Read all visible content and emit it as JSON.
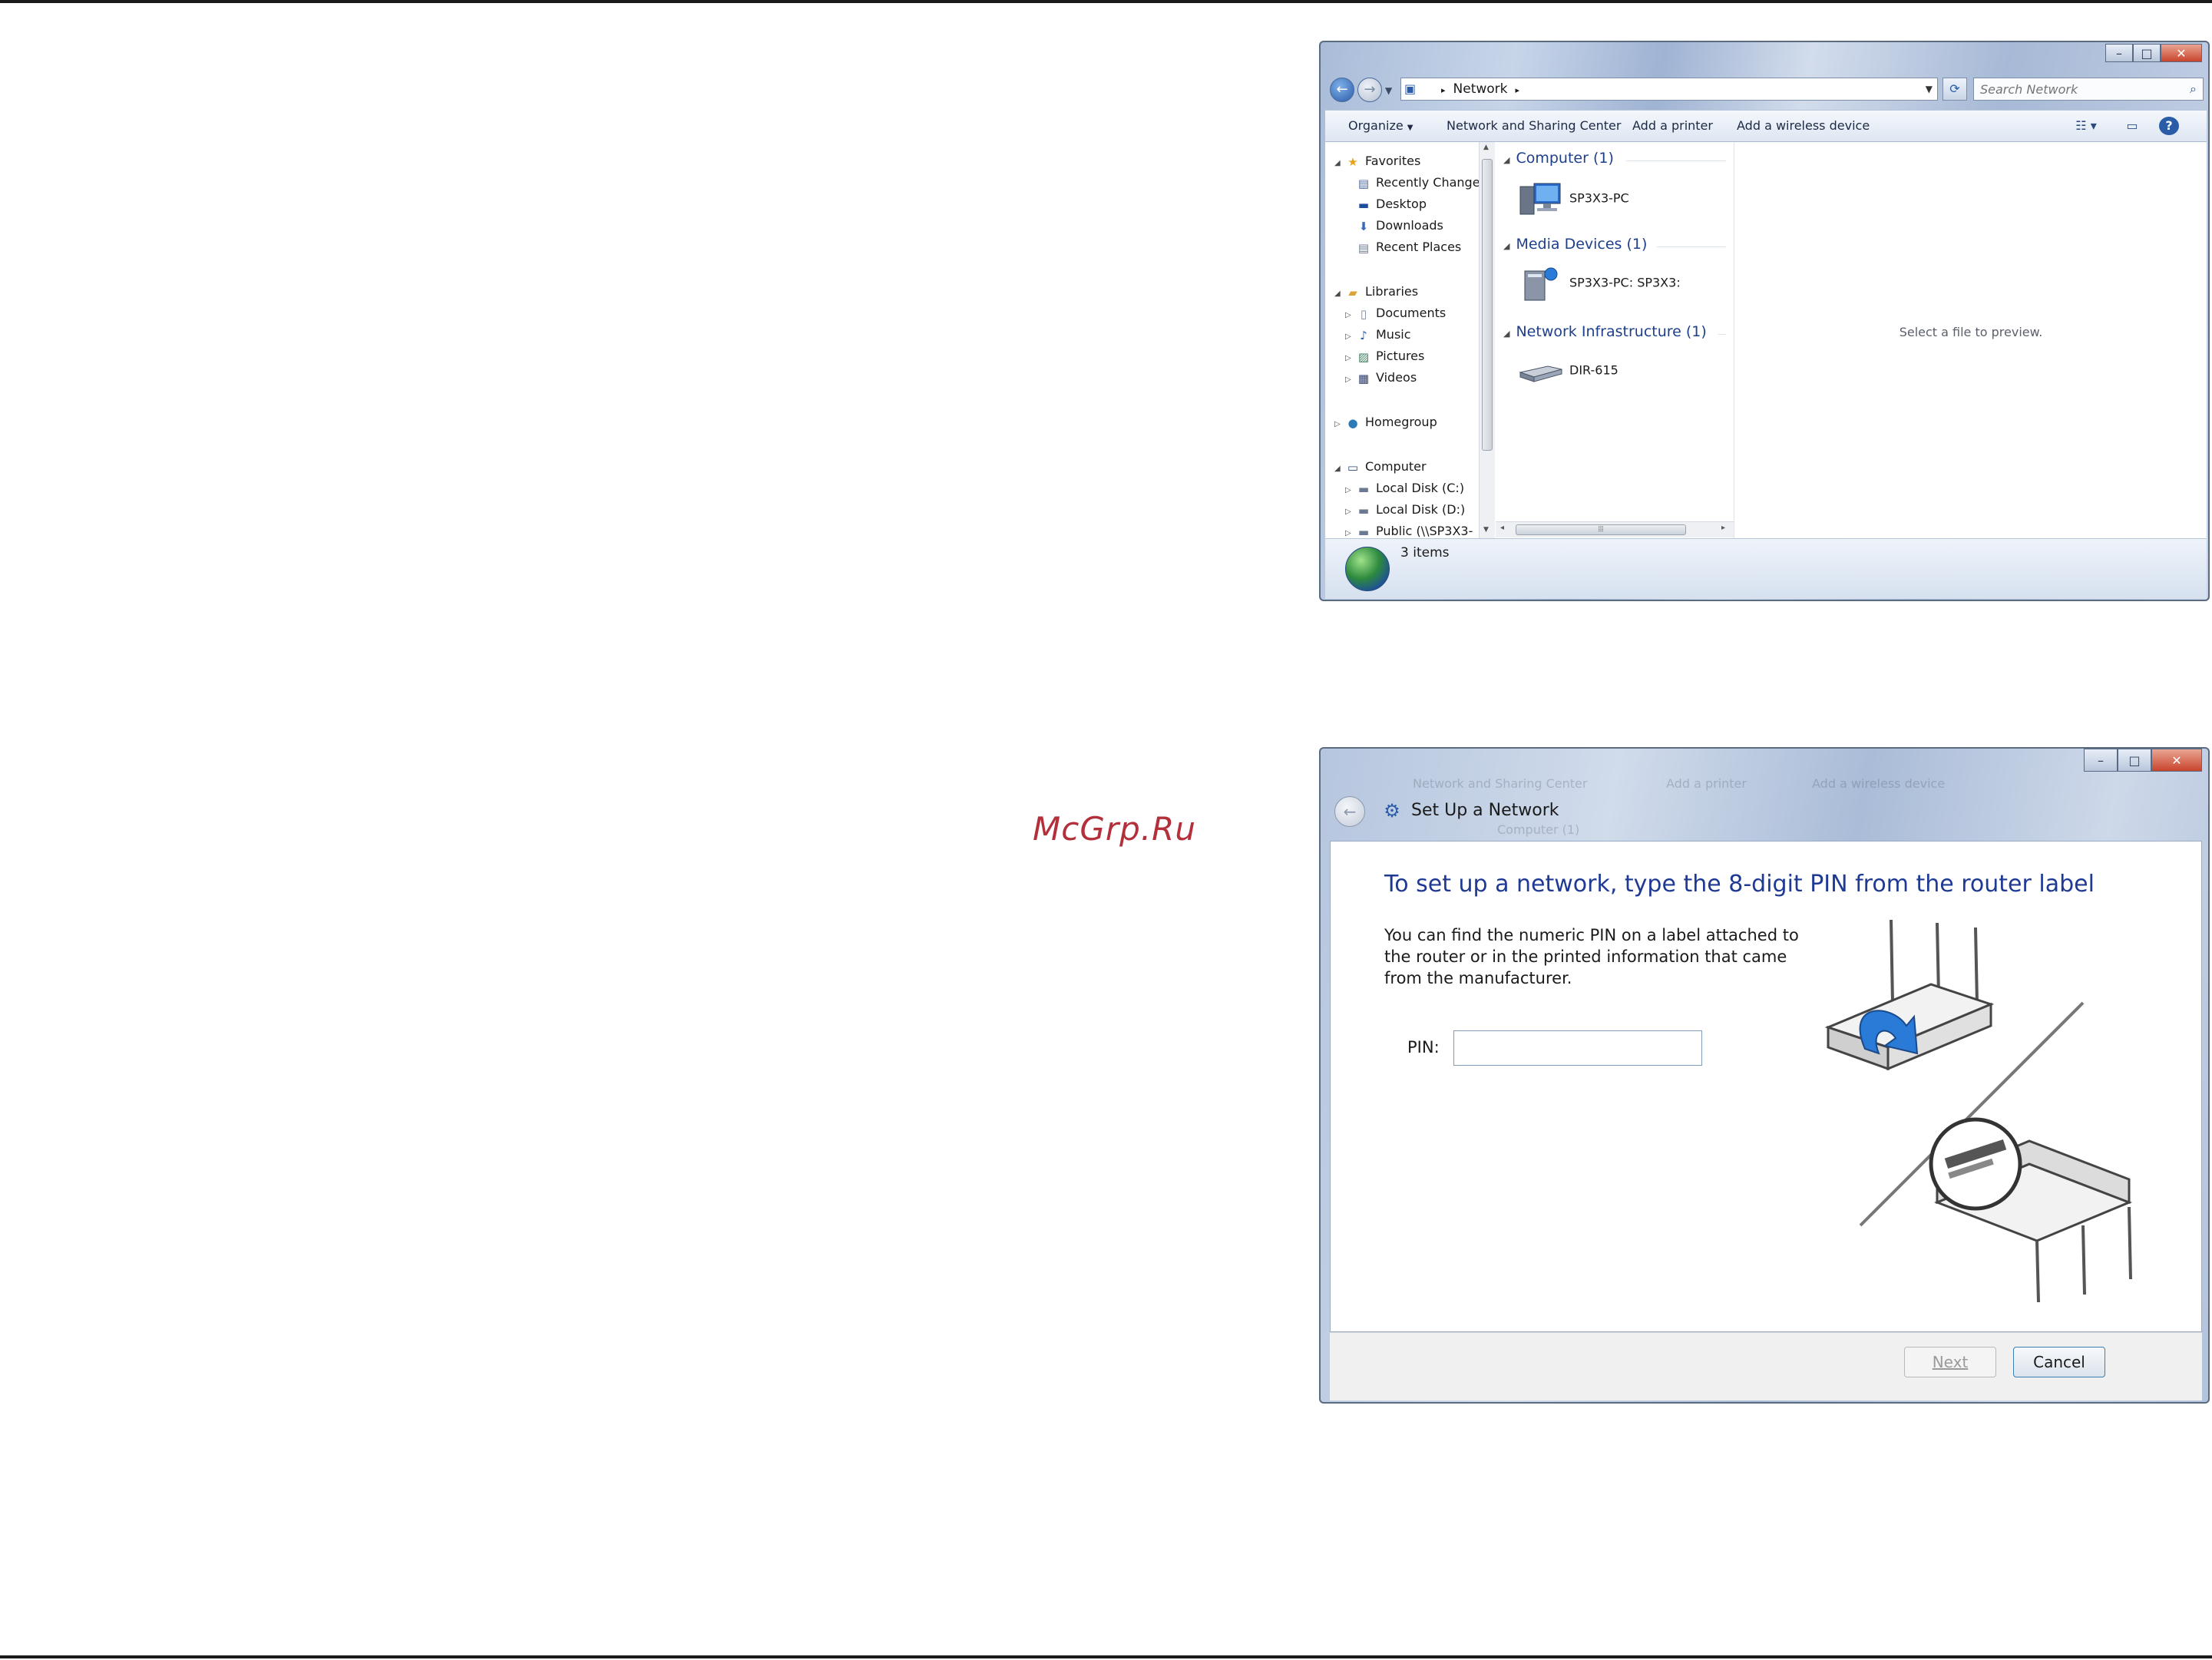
{
  "watermark": "McGrp.Ru",
  "explorer": {
    "address": "Network",
    "search_placeholder": "Search Network",
    "toolbar": [
      "Organize",
      "Network and Sharing Center",
      "Add a printer",
      "Add a wireless device"
    ],
    "nav": {
      "favorites": "Favorites",
      "recently_changed": "Recently Change",
      "desktop": "Desktop",
      "downloads": "Downloads",
      "recent_places": "Recent Places",
      "libraries": "Libraries",
      "documents": "Documents",
      "music": "Music",
      "pictures": "Pictures",
      "videos": "Videos",
      "homegroup": "Homegroup",
      "computer": "Computer",
      "local_c": "Local Disk (C:)",
      "local_d": "Local Disk (D:)",
      "public": "Public (\\\\SP3X3-"
    },
    "groups": [
      {
        "title": "Computer (1)",
        "item": "SP3X3-PC"
      },
      {
        "title": "Media Devices (1)",
        "item": "SP3X3-PC: SP3X3:"
      },
      {
        "title": "Network Infrastructure (1)",
        "item": "DIR-615"
      }
    ],
    "preview_text": "Select a file to preview.",
    "status": "3 items"
  },
  "setup": {
    "title": "Set Up a Network",
    "ghost_items": [
      "Network and Sharing Center",
      "Add a printer",
      "Add a wireless device",
      "Computer (1)"
    ],
    "heading": "To set up a network, type the 8-digit PIN from the router label",
    "description": "You can find the numeric PIN on a label attached to the router or in the printed information that came from the manufacturer.",
    "pin_label": "PIN:",
    "pin_value": "",
    "next_label": "Next",
    "cancel_label": "Cancel"
  }
}
